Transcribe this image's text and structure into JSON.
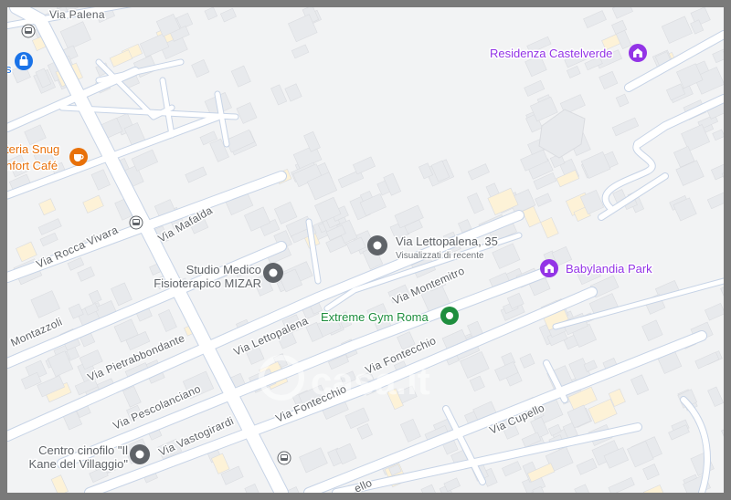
{
  "streets": {
    "via_palena": "Via Palena",
    "via_mafalda": "Via Mafalda",
    "via_rocca_vivara": "Via Rocca Vivara",
    "via_montazzoli": "Montazzoli",
    "via_pietrabbondante": "Via Pietrabbondante",
    "via_lettopalena": "Via Lettopalena",
    "via_montemitro": "Via Montemitro",
    "via_fontecchio_upper": "Via Fontecchio",
    "via_fontecchio_lower": "Via Fontecchio",
    "via_pescolanciano": "Via Pescolanciano",
    "via_vastogirardi": "Via Vastogirardi",
    "via_cupello": "Via Cupello",
    "via_cupello_partial": "ello"
  },
  "pois": {
    "residenza": {
      "label": "Residenza Castelverde",
      "icon": "building-icon",
      "color": "#9334e6"
    },
    "babylandia": {
      "label": "Babylandia Park",
      "icon": "building-icon",
      "color": "#9334e6"
    },
    "selected_address": {
      "label": "Via Lettopalena, 35",
      "sublabel": "Visualizzati di recente",
      "icon": "location-pin-icon",
      "color": "#5f6368"
    },
    "studio_medico": {
      "line1": "Studio Medico",
      "line2": "Fisioterapico MIZAR",
      "icon": "location-pin-icon",
      "color": "#5f6368"
    },
    "extreme_gym": {
      "label": "Extreme Gym Roma",
      "icon": "location-pin-icon",
      "color": "#1e8e3e"
    },
    "centro_cinofilo": {
      "line1": "Centro cinofilo \"Il",
      "line2": "Kane del Villaggio\"",
      "icon": "location-pin-icon",
      "color": "#5f6368"
    },
    "cafe": {
      "line1": "teria Snug",
      "line2": "nfort Café",
      "icon": "coffee-cup-icon",
      "color": "#e8710a"
    },
    "shop": {
      "label": "s",
      "icon": "shopping-bag-icon",
      "color": "#1a73e8"
    }
  },
  "watermark": {
    "text": "casa.it"
  },
  "colors": {
    "map_bg": "#f2f3f4",
    "road": "#ffffff",
    "road_outline": "#c6d3e6",
    "building": "#e8eaed",
    "building_stroke": "#dadce0",
    "highlight_building": "#fdf2d7"
  }
}
